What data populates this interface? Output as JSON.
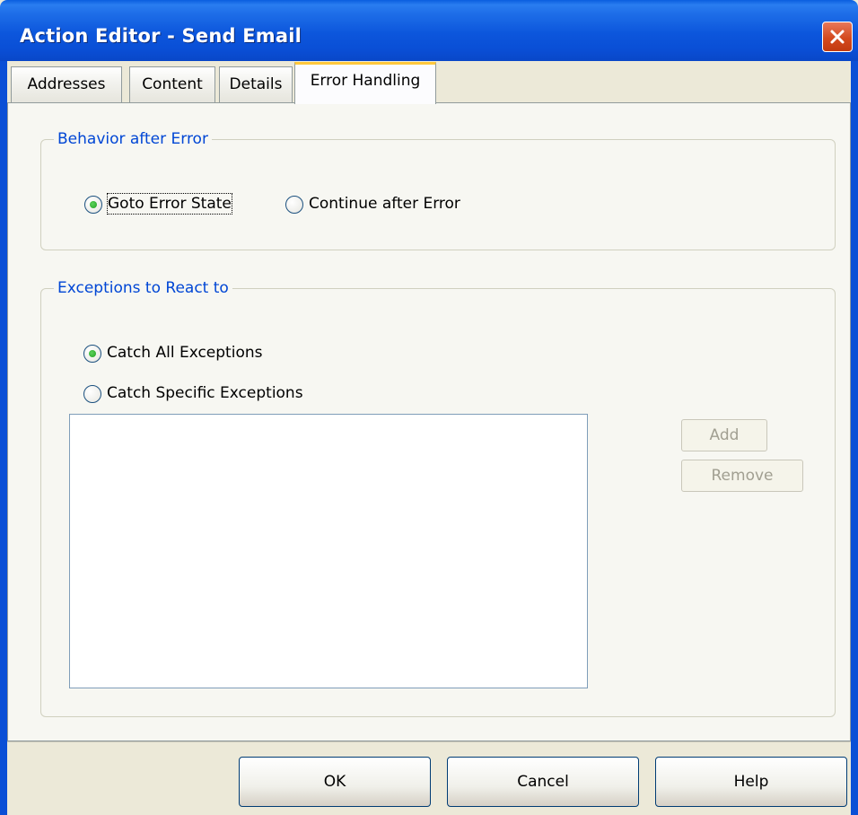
{
  "window": {
    "title": "Action Editor - Send Email"
  },
  "tabs": [
    {
      "label": "Addresses",
      "active": false
    },
    {
      "label": "Content",
      "active": false
    },
    {
      "label": "Details",
      "active": false
    },
    {
      "label": "Error Handling",
      "active": true
    }
  ],
  "behavior_group": {
    "legend": "Behavior after Error",
    "options": [
      {
        "label": "Goto Error State",
        "checked": true
      },
      {
        "label": "Continue after Error",
        "checked": false
      }
    ]
  },
  "exceptions_group": {
    "legend": "Exceptions to React to",
    "options": [
      {
        "label": "Catch All Exceptions",
        "checked": true
      },
      {
        "label": "Catch Specific Exceptions",
        "checked": false
      }
    ],
    "add_label": "Add",
    "remove_label": "Remove"
  },
  "footer": {
    "ok_label": "OK",
    "cancel_label": "Cancel",
    "help_label": "Help"
  },
  "colors": {
    "title_bar": "#0a4fd6",
    "group_legend": "#0046d5",
    "radio_checked": "#21a121",
    "active_tab_accent": "#ffc83c"
  }
}
